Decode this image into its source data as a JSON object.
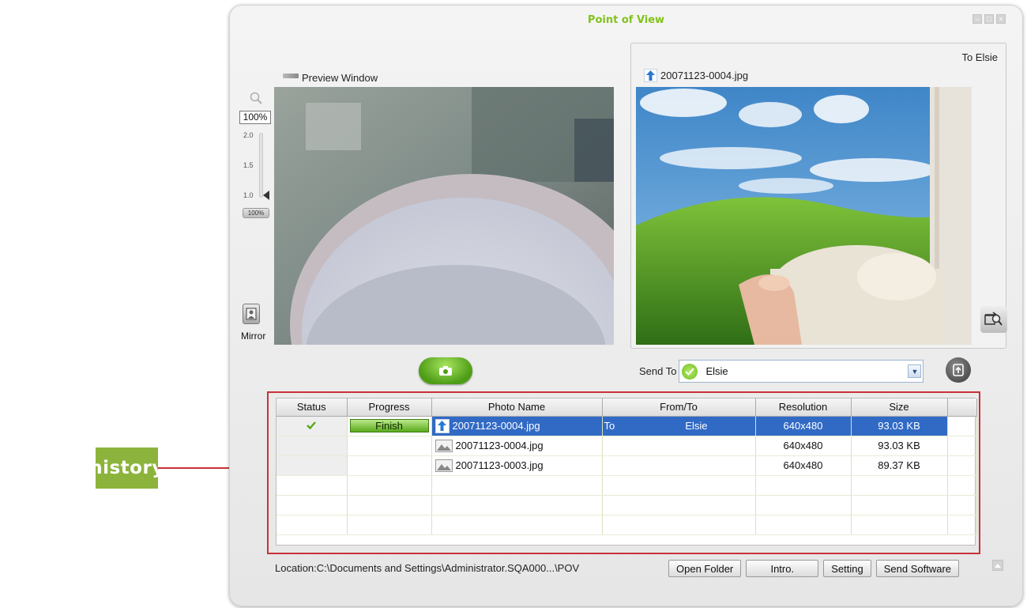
{
  "callout": {
    "label": "history"
  },
  "window": {
    "title": "Point of View"
  },
  "preview": {
    "label": "Preview Window",
    "zoom_percent": "100%",
    "zoom_ticks": [
      "2.0",
      "1.5",
      "1.0"
    ],
    "zoom_reset_label": "100%",
    "mirror_label": "Mirror"
  },
  "received": {
    "to_label": "To  Elsie",
    "filename": "20071123-0004.jpg"
  },
  "send": {
    "label": "Send To",
    "selected": "Elsie"
  },
  "history": {
    "columns": [
      "Status",
      "Progress",
      "Photo Name",
      "From/To",
      "Resolution",
      "Size"
    ],
    "rows": [
      {
        "status": "complete",
        "progress": "Finish",
        "photo_name": "20071123-0004.jpg",
        "direction": "To",
        "contact": "Elsie",
        "resolution": "640x480",
        "size": "93.03 KB",
        "selected": true
      },
      {
        "status": "",
        "progress": "",
        "photo_name": "20071123-0004.jpg",
        "direction": "",
        "contact": "",
        "resolution": "640x480",
        "size": "93.03 KB",
        "selected": false
      },
      {
        "status": "",
        "progress": "",
        "photo_name": "20071123-0003.jpg",
        "direction": "",
        "contact": "",
        "resolution": "640x480",
        "size": "89.37 KB",
        "selected": false
      }
    ]
  },
  "footer": {
    "location": "Location:C:\\Documents and Settings\\Administrator.SQA000...\\POV",
    "buttons": {
      "open_folder": "Open Folder",
      "intro": "Intro.",
      "setting": "Setting",
      "send_software": "Send Software"
    }
  },
  "colors": {
    "accent_green": "#82c21a",
    "callout_green": "#8cb43c",
    "highlight_red": "#c8323a",
    "selection_blue": "#316ac5"
  },
  "icons": [
    "search-icon",
    "camera-icon",
    "mirror-icon",
    "upload-arrow-icon",
    "contact-icon",
    "chevron-down-icon",
    "send-icon",
    "zoom-view-icon",
    "check-icon",
    "image-file-icon",
    "collapse-icon"
  ]
}
